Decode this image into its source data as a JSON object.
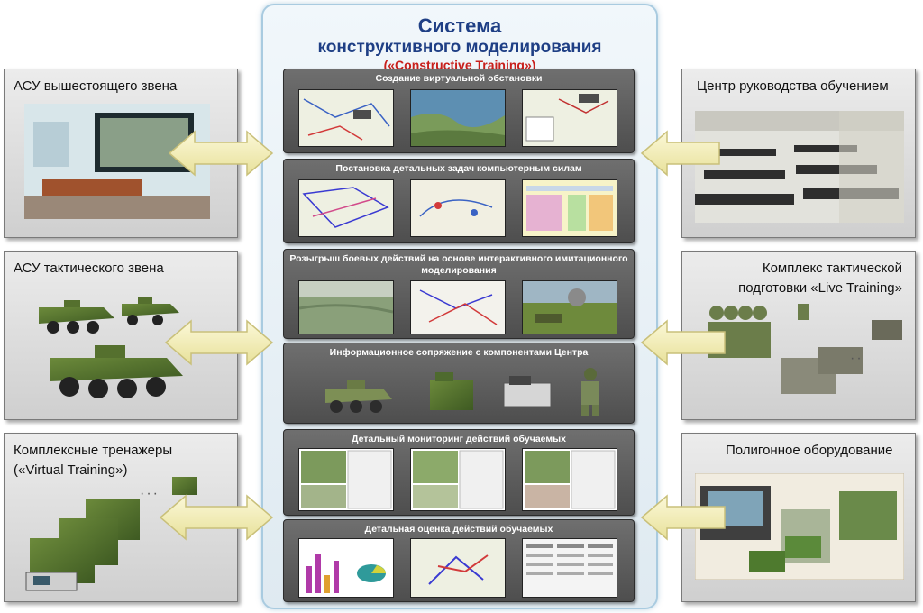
{
  "center": {
    "title_line1": "Система",
    "title_line2": "конструктивного моделирования",
    "title_line3": "(«Constructive Training»)"
  },
  "stages": [
    {
      "label": "Создание виртуальной обстановки"
    },
    {
      "label": "Постановка детальных задач компьютерным силам"
    },
    {
      "label": "Розыгрыш боевых действий на основе интерактивного имитационного моделирования"
    },
    {
      "label": "Информационное сопряжение с компонентами Центра"
    },
    {
      "label": "Детальный мониторинг действий обучаемых"
    },
    {
      "label": "Детальная оценка действий обучаемых"
    }
  ],
  "left": [
    {
      "label": "АСУ вышестоящего звена"
    },
    {
      "label": "АСУ тактического звена"
    },
    {
      "label_line1": "Комплексные тренажеры",
      "label_line2": "(«Virtual Training»)"
    }
  ],
  "right": [
    {
      "label": "Центр руководства обучением"
    },
    {
      "label_line1": "Комплекс тактической",
      "label_line2": "подготовки «Live Training»"
    },
    {
      "label": "Полигонное оборудование"
    }
  ],
  "colors": {
    "arrow_fill": "#f6f1b8",
    "arrow_stroke": "#c9c07a",
    "title": "#1f3f85",
    "title_accent": "#c8201c"
  }
}
